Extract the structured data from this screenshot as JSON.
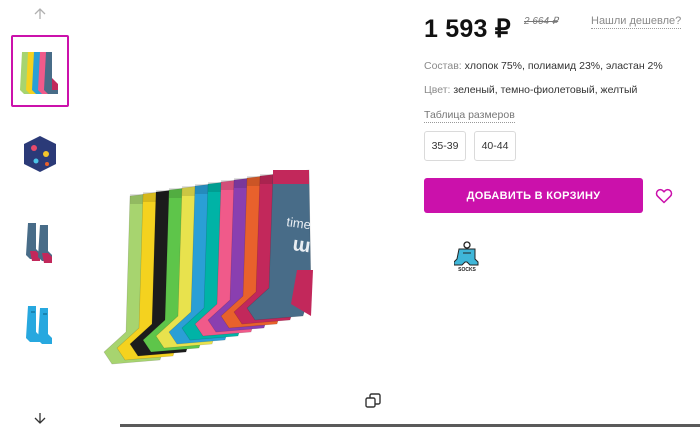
{
  "gallery": {
    "thumbnails": [
      {
        "icon": "socks-set-thumbnail",
        "active": true
      },
      {
        "icon": "gift-box-thumbnail",
        "active": false
      },
      {
        "icon": "socks-pair-red-thumbnail",
        "active": false
      },
      {
        "icon": "socks-pair-cyan-thumbnail",
        "active": false
      }
    ],
    "nav_up_icon": "arrow-up-icon",
    "nav_down_icon": "arrow-down-icon",
    "zoom_icon": "fullscreen-copy-icon"
  },
  "product": {
    "price": "1 593 ₽",
    "old_price": "2 664 ₽",
    "cheaper_link": "Нашли дешевле?",
    "composition_label": "Состав:",
    "composition_value": "хлопок 75%, полиамид 23%, эластан 2%",
    "color_label": "Цвет:",
    "color_value": "зеленый, темно-фиолетовый, желтый",
    "size_table_link": "Таблица размеров",
    "sizes": [
      "35-39",
      "40-44"
    ],
    "add_to_cart": "ДОБАВИТЬ В КОРЗИНУ",
    "brand_logo_text": "SOCKS"
  },
  "colors": {
    "accent": "#cb11ab",
    "sock_colors": [
      "#a7d46f",
      "#f4d21f",
      "#1c1c1c",
      "#5ec54a",
      "#e8e24d",
      "#2a9fd6",
      "#00b3a6",
      "#f05a8a",
      "#8a3fb0",
      "#e8612c",
      "#c2285b",
      "#486c88"
    ]
  }
}
